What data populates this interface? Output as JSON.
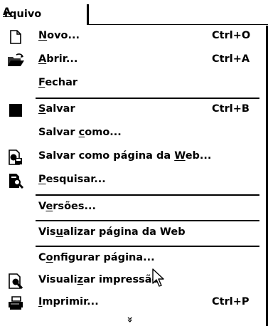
{
  "menu_title": {
    "pre": "",
    "ul": "A",
    "post": "rquivo"
  },
  "items": [
    {
      "pre": "",
      "ul": "N",
      "post": "ovo...",
      "shortcut": "Ctrl+O",
      "icon": "new-document-icon"
    },
    {
      "pre": "",
      "ul": "A",
      "post": "brir...",
      "shortcut": "Ctrl+A",
      "icon": "open-folder-icon"
    },
    {
      "pre": "",
      "ul": "F",
      "post": "echar",
      "shortcut": "",
      "icon": ""
    },
    {
      "pre": "",
      "ul": "S",
      "post": "alvar",
      "shortcut": "Ctrl+B",
      "icon": "save-icon"
    },
    {
      "pre": "Salvar ",
      "ul": "c",
      "post": "omo...",
      "shortcut": "",
      "icon": ""
    },
    {
      "pre": "Salvar como página da ",
      "ul": "W",
      "post": "eb...",
      "shortcut": "",
      "icon": "save-as-web-page-icon"
    },
    {
      "pre": "",
      "ul": "P",
      "post": "esquisar...",
      "shortcut": "",
      "icon": "search-file-icon"
    },
    {
      "pre": "V",
      "ul": "e",
      "post": "rsões...",
      "shortcut": "",
      "icon": ""
    },
    {
      "pre": "Vis",
      "ul": "u",
      "post": "alizar página da Web",
      "shortcut": "",
      "icon": ""
    },
    {
      "pre": "C",
      "ul": "o",
      "post": "nfigurar página...",
      "shortcut": "",
      "icon": ""
    },
    {
      "pre": "Visuali",
      "ul": "z",
      "post": "ar impressão",
      "shortcut": "",
      "icon": "print-preview-icon"
    },
    {
      "pre": "",
      "ul": "I",
      "post": "mprimir...",
      "shortcut": "Ctrl+P",
      "icon": "printer-icon"
    }
  ],
  "expand_glyph": "»",
  "colors": {
    "background": "#ffffff",
    "text": "#000000"
  }
}
